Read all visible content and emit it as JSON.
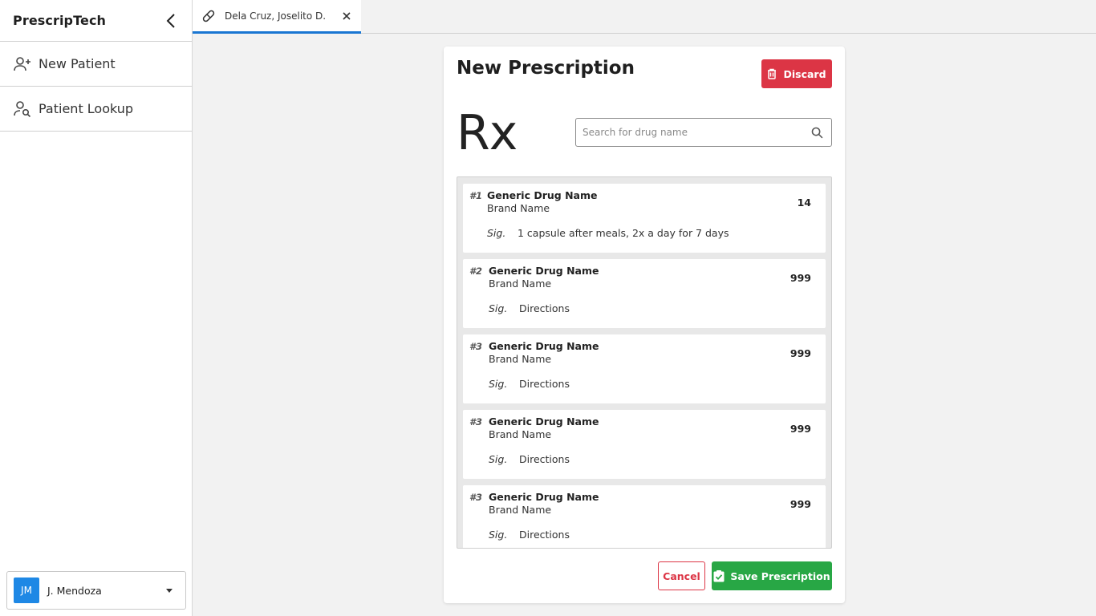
{
  "app": {
    "title": "PrescripTech"
  },
  "sidebar": {
    "items": [
      {
        "label": "New Patient",
        "icon": "add-user-icon"
      },
      {
        "label": "Patient Lookup",
        "icon": "user-search-icon"
      }
    ],
    "user": {
      "initials": "JM",
      "name": "J. Mendoza"
    }
  },
  "tabs": [
    {
      "label": "Dela Cruz, Joselito D.",
      "icon": "pill-icon",
      "active": true
    }
  ],
  "prescription": {
    "title": "New Prescription",
    "discard_label": "Discard",
    "rx_symbol": "Rx",
    "search": {
      "placeholder": "Search for drug name",
      "value": ""
    },
    "sig_label": "Sig.",
    "items": [
      {
        "num": "#1",
        "generic": "Generic Drug Name",
        "brand": "Brand Name",
        "qty": "14",
        "sig": "1 capsule after meals, 2x a day for 7 days"
      },
      {
        "num": "#2",
        "generic": "Generic Drug Name",
        "brand": "Brand Name",
        "qty": "999",
        "sig": "Directions"
      },
      {
        "num": "#3",
        "generic": "Generic Drug Name",
        "brand": "Brand Name",
        "qty": "999",
        "sig": "Directions"
      },
      {
        "num": "#3",
        "generic": "Generic Drug Name",
        "brand": "Brand Name",
        "qty": "999",
        "sig": "Directions"
      },
      {
        "num": "#3",
        "generic": "Generic Drug Name",
        "brand": "Brand Name",
        "qty": "999",
        "sig": "Directions"
      }
    ],
    "cancel_label": "Cancel",
    "save_label": "Save Prescription"
  },
  "colors": {
    "accent": "#1976d2",
    "danger": "#dc3545",
    "success": "#28a745",
    "avatar": "#1e88e5"
  }
}
